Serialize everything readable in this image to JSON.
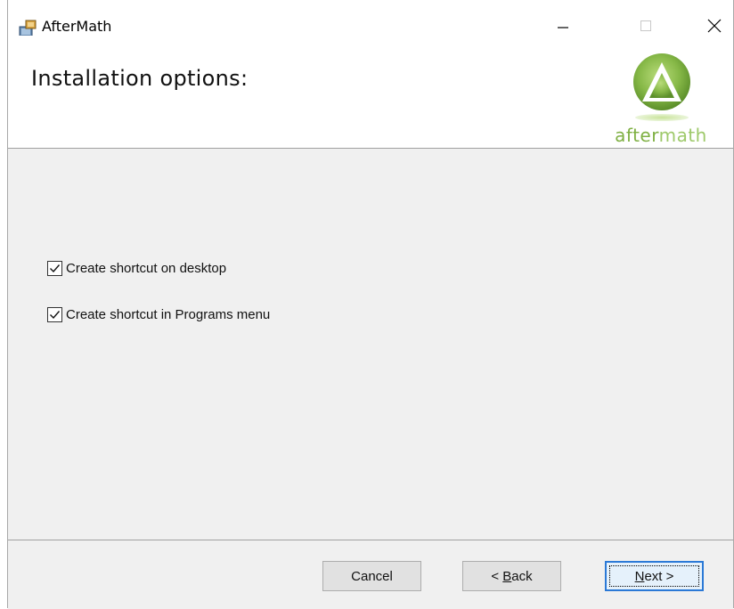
{
  "window": {
    "title": "AfterMath",
    "minimize_glyph": "—",
    "maximize_glyph": "☐",
    "close_glyph": "✕"
  },
  "header": {
    "title": "Installation options:",
    "logo_text_part1": "after",
    "logo_text_part2": "math"
  },
  "options": [
    {
      "label": "Create shortcut on desktop",
      "checked": true
    },
    {
      "label": "Create shortcut in Programs menu",
      "checked": true
    }
  ],
  "buttons": {
    "cancel": "Cancel",
    "back_prefix": "< ",
    "back_underlined": "B",
    "back_rest": "ack",
    "next_underlined": "N",
    "next_rest": "ext >"
  },
  "colors": {
    "accent_focus": "#2b79d6",
    "logo_green": "#7fb043",
    "logo_light_green": "#9ec96a",
    "dialog_background": "#f0f0f0"
  },
  "icons": {
    "app": "installer-icon",
    "logo": "aftermath-logo"
  }
}
